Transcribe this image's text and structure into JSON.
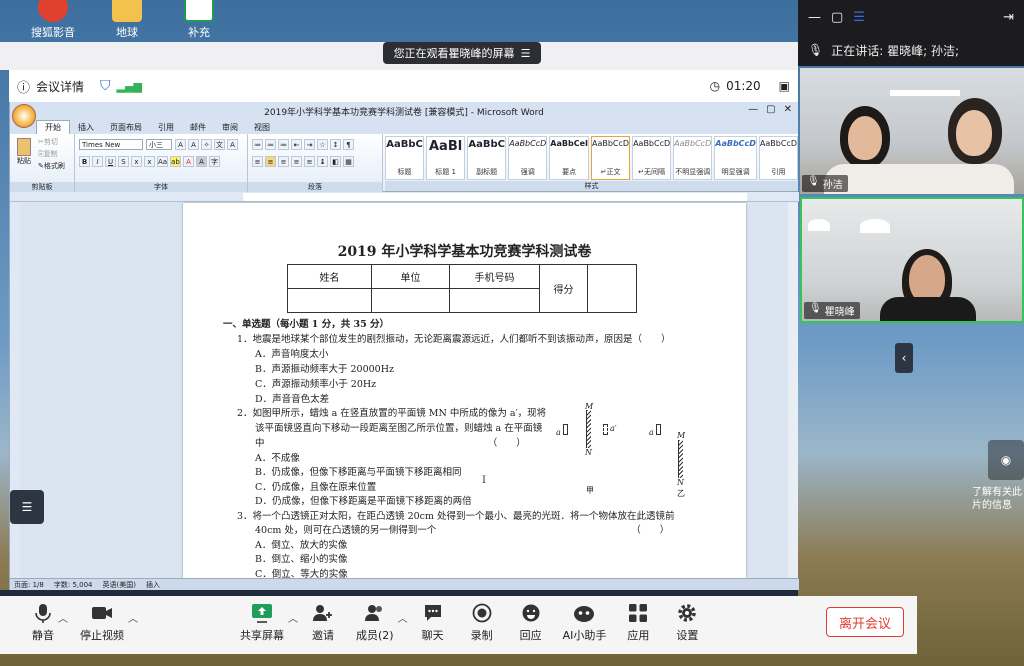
{
  "desktop": {
    "icons": [
      {
        "label": "搜狐影音"
      },
      {
        "label": "地球"
      },
      {
        "label": "补充"
      }
    ],
    "right_text": "了解有关此\n片的信息"
  },
  "share_banner": {
    "text": "您正在观看瞿晓峰的屏幕",
    "menu_icon": "list-icon"
  },
  "meeting_header": {
    "details": "会议详情",
    "timer": "01:20"
  },
  "word": {
    "window_title": "2019年小学科学基本功竞赛学科测试卷 [兼容模式] - Microsoft Word",
    "tabs": [
      "开始",
      "插入",
      "页面布局",
      "引用",
      "邮件",
      "审阅",
      "视图"
    ],
    "clipboard": {
      "paste": "粘贴",
      "cut": "剪切",
      "copy": "复制",
      "format_painter": "格式刷"
    },
    "font_name": "Times New Roma",
    "font_size": "小三",
    "groups": {
      "clipboard": "剪贴板",
      "font": "字体",
      "paragraph": "段落",
      "styles": "样式"
    },
    "styles": [
      {
        "preview": "AaBbC",
        "name": "标题"
      },
      {
        "preview": "AaBl",
        "name": "标题 1"
      },
      {
        "preview": "AaBbC",
        "name": "副标题"
      },
      {
        "preview": "AaBbCcD",
        "name": "强调"
      },
      {
        "preview": "AaBbCeI",
        "name": "要点"
      },
      {
        "preview": "AaBbCcD",
        "name": "↵正文"
      },
      {
        "preview": "AaBbCcD",
        "name": "↵无间隔"
      },
      {
        "preview": "AaBbCcD",
        "name": "不明显强调"
      },
      {
        "preview": "AaBbCcD",
        "name": "明显强调"
      },
      {
        "preview": "AaBbCcD",
        "name": "引用"
      }
    ],
    "doc": {
      "title": "2019 年小学科学基本功竞赛学科测试卷",
      "table_headers": [
        "姓名",
        "单位",
        "手机号码",
        "得分"
      ],
      "section": "一、单选题（每小题 1 分，共 35 分）",
      "questions": [
        {
          "stem": [
            "1．地震是地球某个部位发生的剧烈振动，无论距离震源远近，人们都听不到该振动声，原因是（　　）"
          ],
          "options": [
            "A．声音响度太小",
            "B．声源振动频率大于 20000Hz",
            "C．声源振动频率小于 20Hz",
            "D．声音音色太差"
          ]
        },
        {
          "stem": [
            "2．如图甲所示，蜡烛 a 在竖直放置的平面镜 MN 中所成的像为 a′，现将",
            "该平面镜竖直向下移动一段距离至图乙所示位置，则蜡烛 a 在平面镜",
            "中　　　　　　　　　　　　　　　　　　　　　　　　（　　）"
          ],
          "options": [
            "A．不成像",
            "B．仍成像，但像下移距离与平面镜下移距离相同",
            "C．仍成像，且像在原来位置",
            "D．仍成像，但像下移距离是平面镜下移距离的两倍"
          ]
        },
        {
          "stem": [
            "3．将一个凸透镜正对太阳，在距凸透镜  20cm  处得到一个最小、最亮的光斑．将一个物体放在此透镜前",
            "40cm 处，则可在凸透镜的另一侧得到一个　　　　　　　　　　　　　　　　　　　　　（　　）"
          ],
          "options": [
            "A．倒立、放大的实像",
            "B．倒立、缩小的实像",
            "C．倒立、等大的实像"
          ]
        }
      ],
      "figure_labels": {
        "m": "M",
        "n": "N",
        "a": "a",
        "a_prime": "a′",
        "fig1": "甲",
        "fig2": "乙"
      }
    },
    "status": {
      "page": "页面: 1/8",
      "words": "字数: 5,004",
      "lang": "英语(美国)",
      "mode": "插入"
    }
  },
  "toolbar": {
    "items": [
      {
        "label": "静音",
        "icon": "microphone-icon",
        "caret": true
      },
      {
        "label": "停止视频",
        "icon": "video-camera-icon",
        "caret": true
      },
      {
        "label": "共享屏幕",
        "icon": "share-screen-icon",
        "caret": true
      },
      {
        "label": "邀请",
        "icon": "invite-icon"
      },
      {
        "label": "成员(2)",
        "icon": "members-icon",
        "caret": true
      },
      {
        "label": "聊天",
        "icon": "chat-icon"
      },
      {
        "label": "录制",
        "icon": "record-icon"
      },
      {
        "label": "回应",
        "icon": "reaction-icon"
      },
      {
        "label": "AI小助手",
        "icon": "ai-assistant-icon"
      },
      {
        "label": "应用",
        "icon": "apps-icon"
      },
      {
        "label": "设置",
        "icon": "settings-icon"
      }
    ],
    "leave": "离开会议"
  },
  "right_panel": {
    "speaking": "正在讲话:  瞿晓峰; 孙洁;",
    "participants": [
      {
        "name": "孙洁"
      },
      {
        "name": "瞿晓峰"
      }
    ]
  },
  "colors": {
    "accent": "#2f6fe8",
    "leave": "#e03d2f",
    "active_border": "#35c35d"
  }
}
